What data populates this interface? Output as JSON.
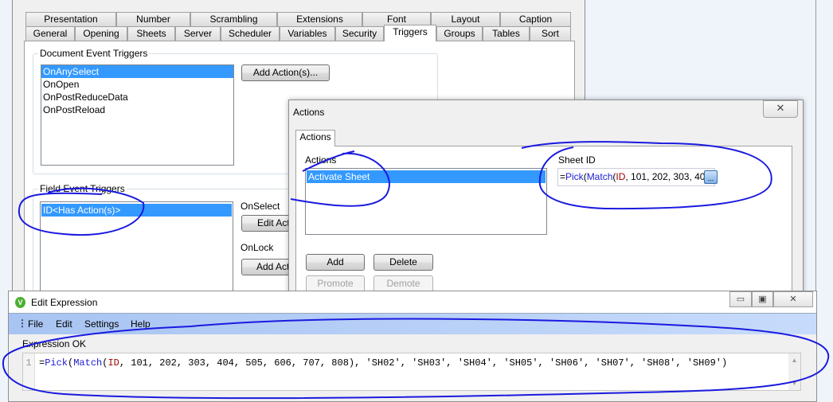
{
  "properties": {
    "tabs_row1": [
      "Presentation",
      "Number",
      "Scrambling",
      "Extensions",
      "Font",
      "Layout",
      "Caption"
    ],
    "tabs_row2": [
      "General",
      "Opening",
      "Sheets",
      "Server",
      "Scheduler",
      "Variables",
      "Security",
      "Triggers",
      "Groups",
      "Tables",
      "Sort"
    ],
    "active_tab": "Triggers",
    "document_triggers": {
      "label": "Document Event Triggers",
      "items": [
        "OnAnySelect",
        "OnOpen",
        "OnPostReduceData",
        "OnPostReload"
      ],
      "selected": "OnAnySelect",
      "add_button": "Add Action(s)..."
    },
    "field_triggers": {
      "label": "Field Event Triggers",
      "items": [
        "ID<Has Action(s)>"
      ],
      "onselect_label": "OnSelect",
      "edit_button": "Edit Actions",
      "onlock_label": "OnLock",
      "add_button": "Add Actions"
    }
  },
  "actions_dialog": {
    "title": "Actions",
    "close": "✕",
    "tab": "Actions",
    "list_label": "Actions",
    "items": [
      "Activate Sheet"
    ],
    "sheet_id_label": "Sheet ID",
    "sheet_id_value": {
      "eq": "=",
      "f1": "Pick",
      "p1": "(",
      "f2": "Match",
      "p2": "(",
      "field": "ID",
      "rest": ", 101, 202, 303, 40"
    },
    "browse": "...",
    "buttons": {
      "add": "Add",
      "delete": "Delete",
      "promote": "Promote",
      "demote": "Demote"
    }
  },
  "edit_expression": {
    "title": "Edit Expression",
    "window_buttons": {
      "minimize": "▭",
      "maximize": "▣",
      "close": "✕"
    },
    "menu": [
      "File",
      "Edit",
      "Settings",
      "Help"
    ],
    "status": "Expression OK",
    "line_number": "1",
    "code": {
      "eq": "=",
      "f1": "Pick",
      "p1": "(",
      "f2": "Match",
      "p2": "(",
      "field": "ID",
      "rest": ", 101, 202, 303, 404, 505, 606, 707, 808), 'SH02', 'SH03', 'SH04', 'SH05', 'SH06', 'SH07', 'SH08', 'SH09')"
    }
  },
  "colors": {
    "selection": "#3399ff",
    "annotation": "#1a1adf",
    "menu_bar": "#a8c4f2"
  }
}
